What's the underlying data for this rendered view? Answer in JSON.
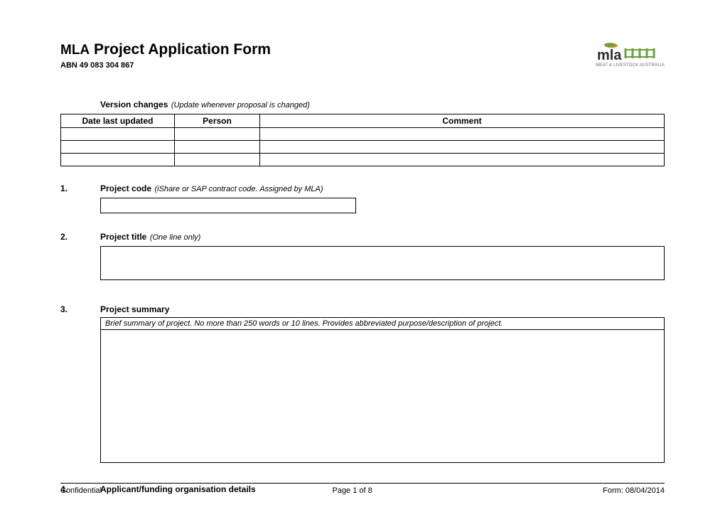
{
  "header": {
    "title_prefix": "MLA",
    "title_main": "Project Application Form",
    "abn": "ABN 49 083 304 867",
    "logo_text": "mla",
    "logo_sub": "MEAT & LIVESTOCK AUSTRALIA"
  },
  "version_changes": {
    "heading": "Version changes",
    "note": "(Update whenever proposal is changed)",
    "columns": {
      "date": "Date last updated",
      "person": "Person",
      "comment": "Comment"
    },
    "rows": [
      {
        "date": "",
        "person": "",
        "comment": ""
      },
      {
        "date": "",
        "person": "",
        "comment": ""
      },
      {
        "date": "",
        "person": "",
        "comment": ""
      }
    ]
  },
  "sections": {
    "s1": {
      "num": "1.",
      "label": "Project code",
      "note": "(iShare or SAP contract code. Assigned by MLA)",
      "value": ""
    },
    "s2": {
      "num": "2.",
      "label": "Project title",
      "note": "(One line only)",
      "value": ""
    },
    "s3": {
      "num": "3.",
      "label": "Project summary",
      "hint": "Brief summary of project. No more than 250 words or 10 lines. Provides abbreviated purpose/description of project.",
      "value": ""
    },
    "s4": {
      "num": "4.",
      "label": "Applicant/funding organisation details"
    }
  },
  "footer": {
    "left": "Confidential",
    "center": "Page 1 of 8",
    "right": "Form: 08/04/2014"
  },
  "colors": {
    "logo_green": "#6aa23a",
    "logo_dark": "#2b2b2b",
    "logo_accent": "#d88b1e"
  }
}
